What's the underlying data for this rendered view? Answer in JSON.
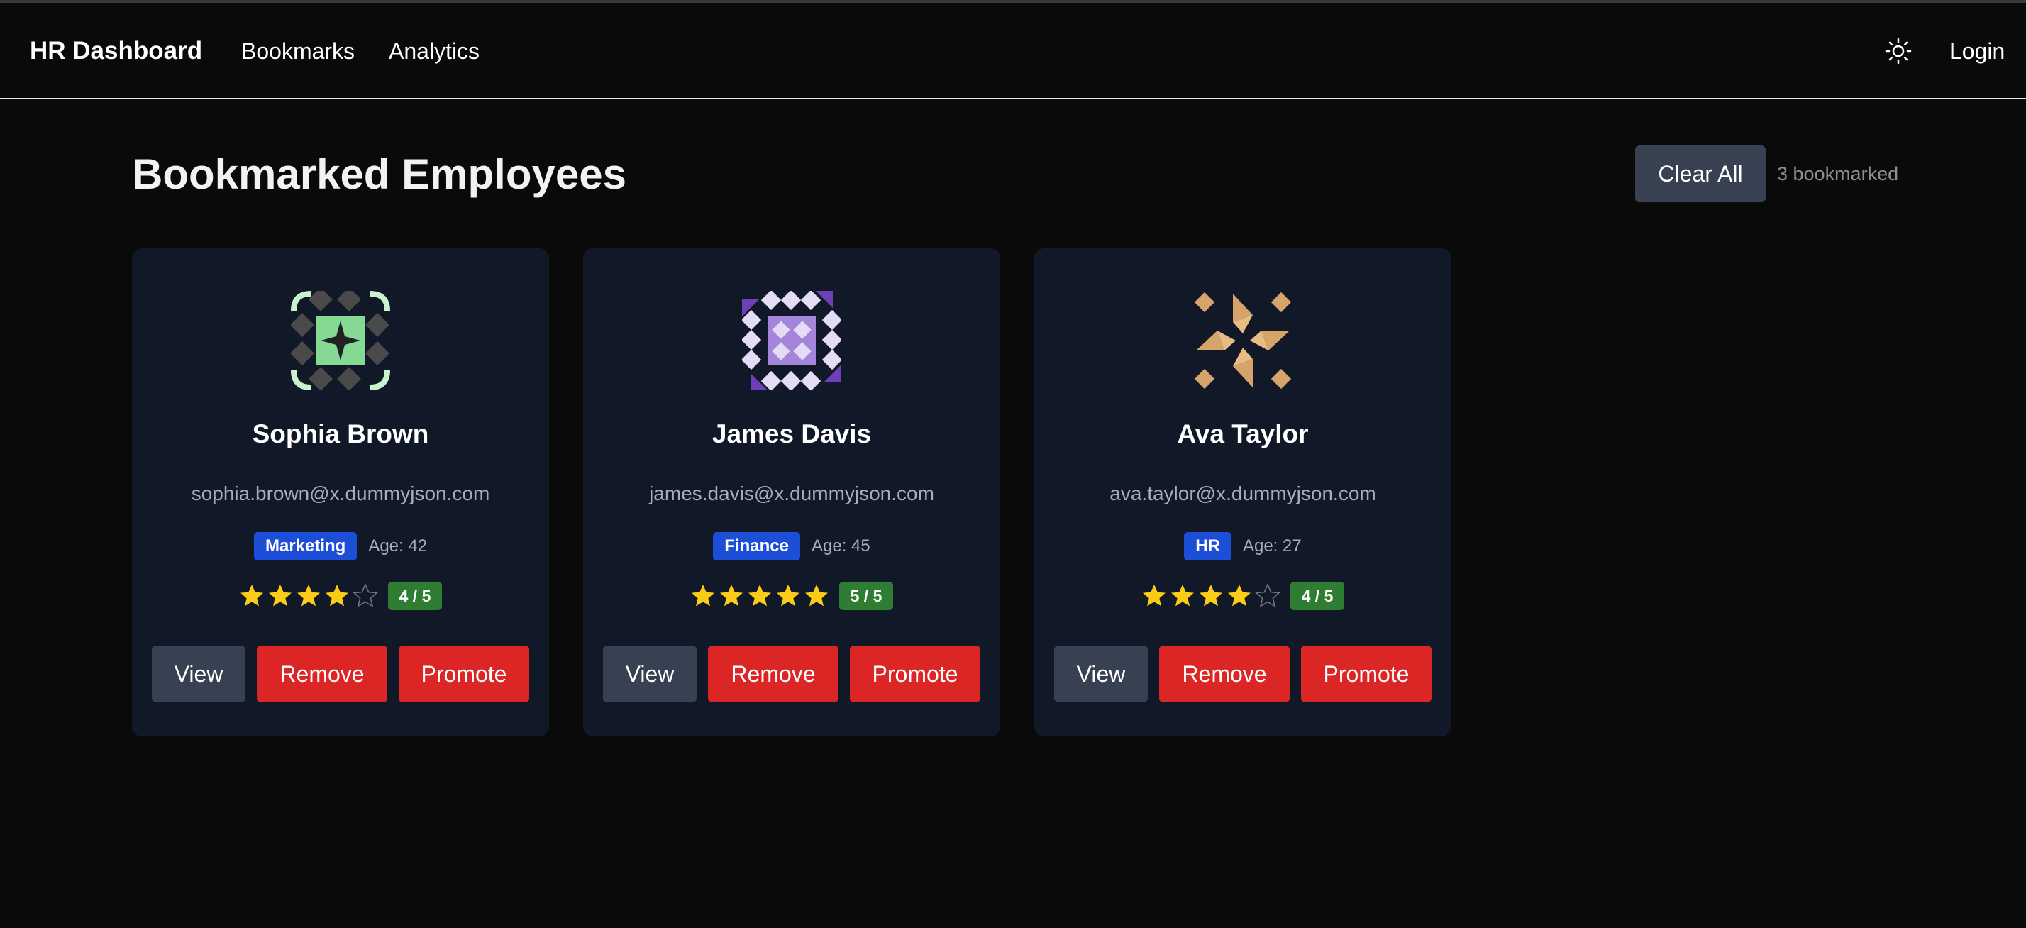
{
  "nav": {
    "brand": "HR Dashboard",
    "links": [
      "Bookmarks",
      "Analytics"
    ],
    "theme_icon": "sun-icon",
    "login": "Login"
  },
  "header": {
    "title": "Bookmarked Employees",
    "clear_all": "Clear All",
    "count": "3 bookmarked"
  },
  "employees": [
    {
      "name": "Sophia Brown",
      "email": "sophia.brown@x.dummyjson.com",
      "department": "Marketing",
      "age": "Age: 42",
      "rating": 4,
      "rating_label": "4 / 5",
      "avatar_color": "#86d993",
      "avatar_accent": "#c9f2cf",
      "avatar_shade": "#4a4a4a"
    },
    {
      "name": "James Davis",
      "email": "james.davis@x.dummyjson.com",
      "department": "Finance",
      "age": "Age: 45",
      "rating": 5,
      "rating_label": "5 / 5",
      "avatar_color": "#a585d9",
      "avatar_accent": "#e4dcf7",
      "avatar_shade": "#6f3fb8"
    },
    {
      "name": "Ava Taylor",
      "email": "ava.taylor@x.dummyjson.com",
      "department": "HR",
      "age": "Age: 27",
      "rating": 4,
      "rating_label": "4 / 5",
      "avatar_color": "#d6a46a",
      "avatar_accent": "#e7bd85",
      "avatar_shade": "#c4945c"
    }
  ],
  "buttons": {
    "view": "View",
    "remove": "Remove",
    "promote": "Promote"
  },
  "colors": {
    "background": "#0a0a0a",
    "card": "#111827",
    "danger": "#dc2626",
    "secondary": "#374151",
    "badge_blue": "#1d4ed8",
    "badge_green": "#2e7d32",
    "star": "#facc15"
  }
}
